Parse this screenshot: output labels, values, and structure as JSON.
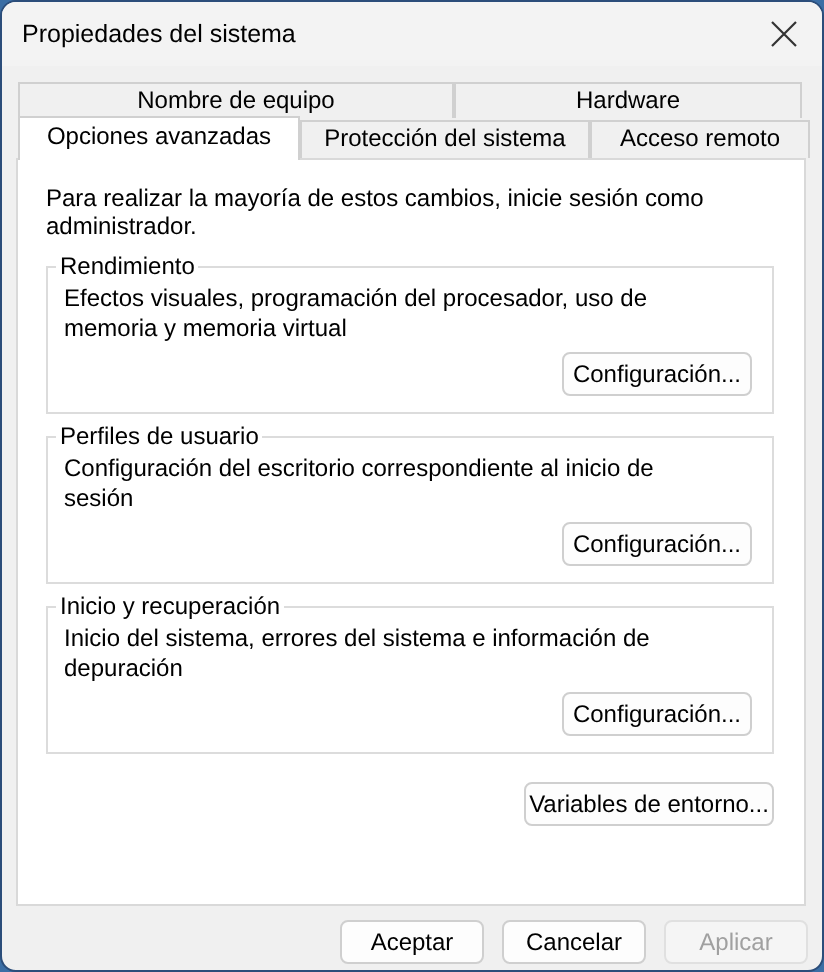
{
  "window": {
    "title": "Propiedades del sistema"
  },
  "tab_rows": [
    {
      "tabs": [
        {
          "label": "Nombre de equipo",
          "selected": false
        },
        {
          "label": "Hardware",
          "selected": false
        }
      ]
    },
    {
      "tabs": [
        {
          "label": "Opciones avanzadas",
          "selected": true
        },
        {
          "label": "Protección del sistema",
          "selected": false
        },
        {
          "label": "Acceso remoto",
          "selected": false
        }
      ]
    }
  ],
  "notice": "Para realizar la mayoría de estos cambios, inicie sesión como administrador.",
  "groups": [
    {
      "title": "Rendimiento",
      "text": "Efectos visuales, programación del procesador, uso de memoria y memoria virtual",
      "button": "Configuración..."
    },
    {
      "title": "Perfiles de usuario",
      "text": "Configuración del escritorio correspondiente al inicio de sesión",
      "button": "Configuración..."
    },
    {
      "title": "Inicio y recuperación",
      "text": "Inicio del sistema, errores del sistema e información de depuración",
      "button": "Configuración..."
    }
  ],
  "env_button": "Variables de entorno...",
  "buttons": [
    {
      "label": "Aceptar",
      "disabled": false
    },
    {
      "label": "Cancelar",
      "disabled": false
    },
    {
      "label": "Aplicar",
      "disabled": true
    }
  ]
}
